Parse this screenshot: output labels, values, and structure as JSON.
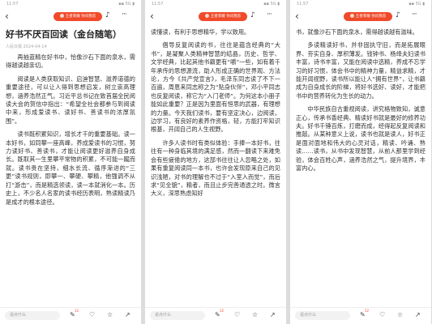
{
  "status": {
    "time": "11:57",
    "signal": "▪▪ 5G ▮"
  },
  "topbar": {
    "pill_label": "王者荣耀 你问我答"
  },
  "icons": {
    "back": "‹",
    "audio": "♪",
    "more": "···",
    "comment": "✎",
    "like": "♡",
    "fav": "☆",
    "share": "↗"
  },
  "article": {
    "title": "好书不厌百回读（金台随笔）",
    "meta": "人民日报 2024-04-14",
    "panel1": [
      "再抽蓝精在好书中，恰像沙石下面的泉水，需得越读越亲切。",
      "阅读是人类获取知识、启迪智慧、滋养道德的重要途径，可以让人得到思想启发，树立崇高理想，涵养浩然正气。习近平总书记在致首届全民阅读大会的贺信中指出：“希望全社会都参与到阅读中来，形成爱读书、读好书、善读书的浓厚氛围”。",
      "读书既积累知识，增长才干的重要基础。读一本好书，如同攀一座高峰，养成爱读书的习惯，努力读好书、善读书，才能让阅读更好滋养自身成长。既取其一生里攀平常物的积累，不可能一蹴而就。读书贵在坚持，细水长流、循序渐进的“三更”读书规则，即攀一、攀硬、攀精，他强调不从打“游击”，而是精选领读，读一本就消化一本。历史上，不少名人名家的读书经历表明，熟读精读乃是成才的根本途径。"
    ],
    "panel2": [
      "读懂读，有利于思想精华，学以致用。",
      "倡导反复阅读的书，往往是蕴含经典的“大书”，是凝聚人类精神智慧的结晶，历史、哲学、文学经典，比起其他书籍更有“嚼”一些，如有着千年承传的思想源流，助人形成正确的世界观、方法论，方今《共产党宣言》，毛泽东同志读了不下一百遍，周恩来同志称之为“贴身伙伴”，邓小平同志也反复阅读，称它为“入门老师”。为何这本小册子能如此重要？正是因为里面有恒思的武器，有理想的力量。今天我们读书，要有坚定决心，边阅读，边学习，有良好的素养作资格，轻，方能打牢知识根基，开阔自己的人生视野。",
      "许多人读书时有类似体验：手捧一本好书，往往有一种身临其境的满足感，然而一翻读下来难免会有些疲倦的地方，这部书往往让人忽略之处，如果有重复阅读同一本书，也许会发现原来自己的见识浅陋，对书的理解也不过于“入室入而觉”，而后求“见全貌”，精者，而且止步完善通透之时。微言大义，深思熟虑知好"
    ],
    "panel3": [
      "书，就像沙石下面的泉水，需得越读越有滋味。",
      "多读精读好书，并非固执守旧，而是拓展眼界、夯实自身、厚积薄发。钱钟书、杨绛夫妇读书丰富，诗书丰富，又能在阅读中选精，养成不忘学习的好习惯，体会书中的精神力量，精益求精，才能开阔视野，读书所以能让人“拥有世界”，让书籍成为自身成长的阶梯，将好书选好、读好，才能把书中的营养转化为生长的动力。",
      "中华民族自古重视阅读，讲究格物致知，诚意正心，传承书香经典、精读好书就是最好的修养功夫。好书千锤百炼，打磨而成，经得起反复阅读和推敲。从某种意义上说，读书也就是读人，好书正是面对面地和伟大的心灵对话，精读、吟诵、熟读……读书，从书中发现智慧，从前人那里学到经验，体会百姓心声，涵养浩然之气，提升境界，丰富内心。"
    ],
    "comment_placeholder": "说点什么",
    "counts": {
      "comment": "12",
      "like": "",
      "fav": "",
      "share": ""
    }
  }
}
